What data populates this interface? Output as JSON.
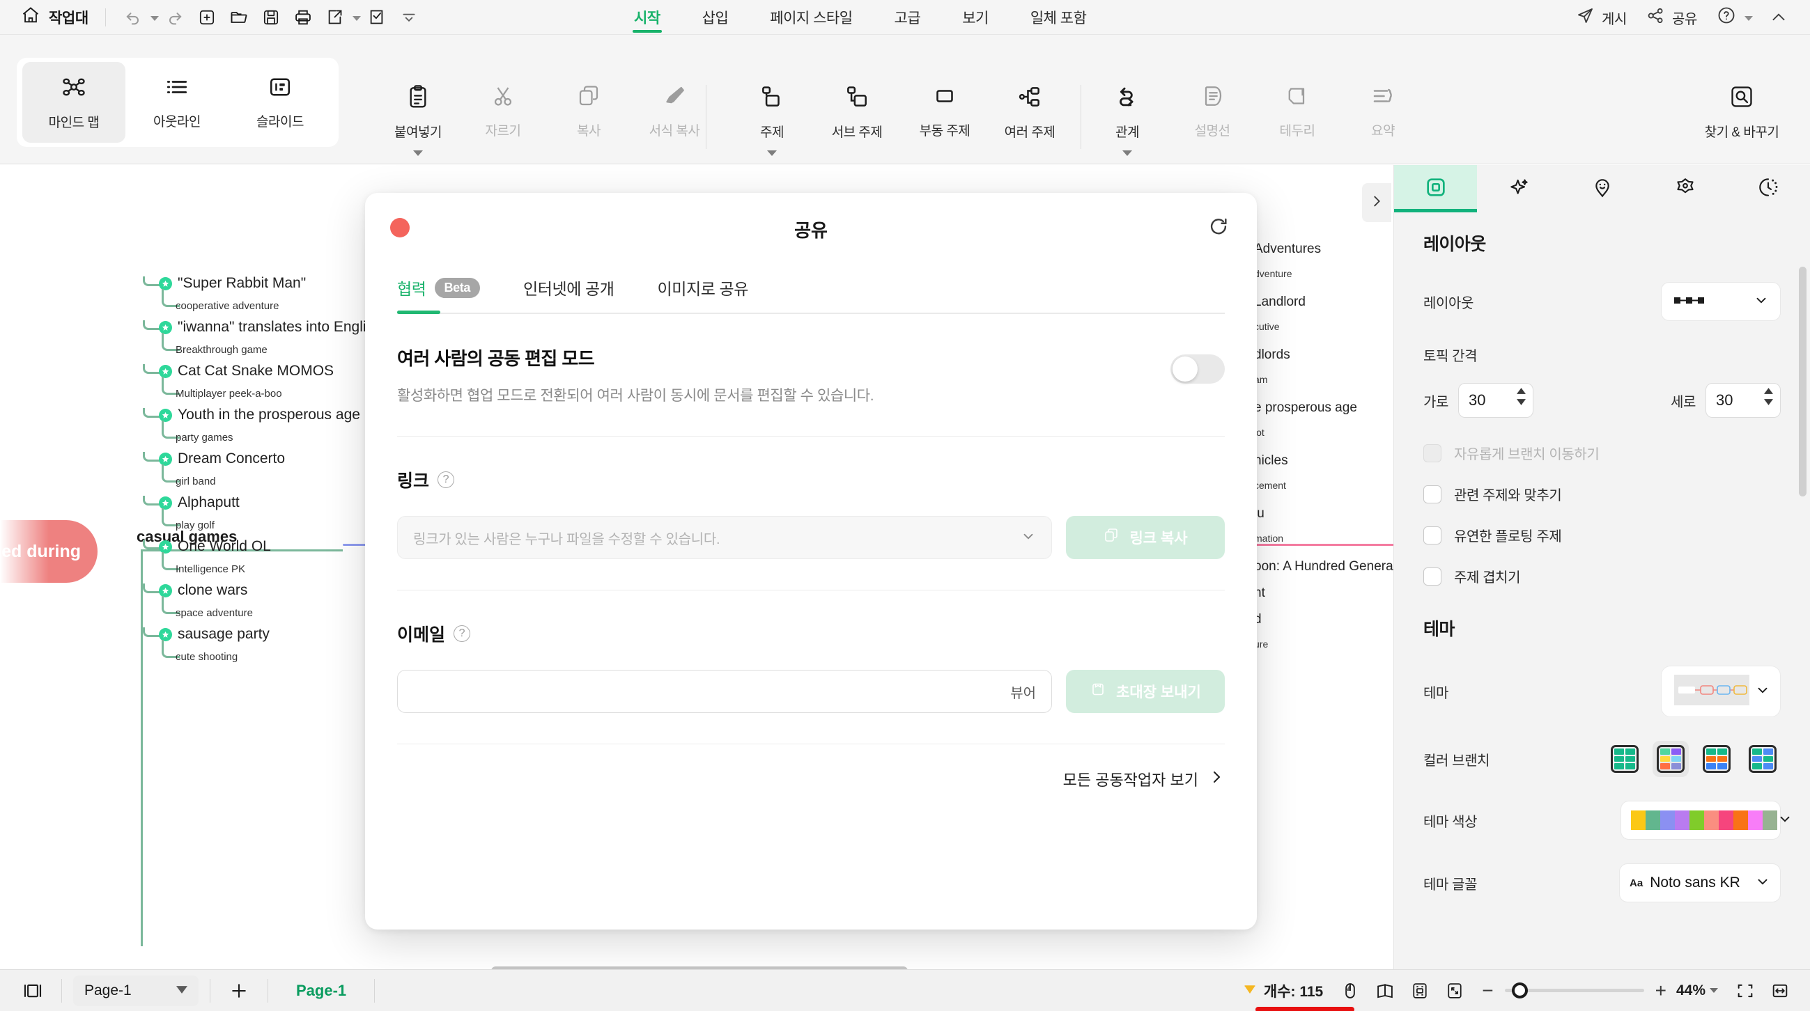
{
  "topbar": {
    "home_label": "작업대",
    "quick_icons": [
      "undo-icon",
      "redo-icon",
      "new-file-icon",
      "open-folder-icon",
      "save-icon",
      "print-icon",
      "export-icon",
      "task-icon",
      "more-icon"
    ],
    "tabs": [
      {
        "label": "시작",
        "active": true
      },
      {
        "label": "삽입",
        "active": false
      },
      {
        "label": "페이지 스타일",
        "active": false
      },
      {
        "label": "고급",
        "active": false
      },
      {
        "label": "보기",
        "active": false
      },
      {
        "label": "일체 포함",
        "active": false
      }
    ],
    "right": [
      {
        "label": "게시",
        "icon": "send-icon"
      },
      {
        "label": "공유",
        "icon": "share-icon"
      }
    ],
    "help_icon": "help-circle-icon",
    "collapse_icon": "chevron-up-icon",
    "accent": "#18b26a"
  },
  "ribbon": {
    "views": [
      {
        "label": "마인드 맵",
        "icon": "mindmap-icon",
        "selected": true,
        "disabled": false
      },
      {
        "label": "아웃라인",
        "icon": "outline-icon",
        "selected": false,
        "disabled": false
      },
      {
        "label": "슬라이드",
        "icon": "slide-icon",
        "selected": false,
        "disabled": false
      }
    ],
    "clipboard": [
      {
        "label": "붙여넣기",
        "icon": "paste-icon",
        "disabled": false,
        "dropdown": true
      },
      {
        "label": "자르기",
        "icon": "cut-icon",
        "disabled": true,
        "dropdown": false
      },
      {
        "label": "복사",
        "icon": "copy-icon",
        "disabled": true,
        "dropdown": false
      },
      {
        "label": "서식 복사",
        "icon": "format-painter-icon",
        "disabled": true,
        "dropdown": false
      }
    ],
    "topics": [
      {
        "label": "주제",
        "icon": "topic-icon",
        "disabled": false,
        "dropdown": true
      },
      {
        "label": "서브 주제",
        "icon": "subtopic-icon",
        "disabled": false,
        "dropdown": false
      },
      {
        "label": "부동 주제",
        "icon": "floating-topic-icon",
        "disabled": false,
        "dropdown": false
      },
      {
        "label": "여러 주제",
        "icon": "multi-topic-icon",
        "disabled": false,
        "dropdown": false
      }
    ],
    "relations": [
      {
        "label": "관계",
        "icon": "relation-icon",
        "disabled": false,
        "dropdown": true
      },
      {
        "label": "설명선",
        "icon": "callout-icon",
        "disabled": true,
        "dropdown": false
      },
      {
        "label": "테두리",
        "icon": "boundary-icon",
        "disabled": true,
        "dropdown": false
      },
      {
        "label": "요약",
        "icon": "summary-icon",
        "disabled": true,
        "dropdown": false
      }
    ],
    "find": {
      "label": "찾기 & 바꾸기",
      "icon": "find-replace-icon"
    }
  },
  "canvas": {
    "root_node": "ed during",
    "branch_title": "casual games",
    "items": [
      {
        "main": "\"Super Rabbit Man\"",
        "sub": "cooperative adventure"
      },
      {
        "main": "\"iwanna\" translates into English as \"I want\".",
        "sub": "Breakthrough game"
      },
      {
        "main": "Cat Cat Snake MOMOS",
        "sub": "Multiplayer peek-a-boo"
      },
      {
        "main": "Youth in the prosperous age",
        "sub": "party games"
      },
      {
        "main": "Dream Concerto",
        "sub": "girl band"
      },
      {
        "main": "Alphaputt",
        "sub": "play golf"
      },
      {
        "main": "One World OL",
        "sub": "Intelligence PK"
      },
      {
        "main": "clone wars",
        "sub": "space adventure"
      },
      {
        "main": "sausage party",
        "sub": "cute shooting"
      }
    ],
    "right_fragments": [
      {
        "text": "Adventures",
        "small": false
      },
      {
        "text": "dventure",
        "small": true
      },
      {
        "text": "Landlord",
        "small": false
      },
      {
        "text": "cutive",
        "small": true
      },
      {
        "text": "dlords",
        "small": false
      },
      {
        "text": "am",
        "small": true
      },
      {
        "text": "e prosperous age",
        "small": false
      },
      {
        "text": "lot",
        "small": true
      },
      {
        "text": "nicles",
        "small": false
      },
      {
        "text": "cement",
        "small": true
      },
      {
        "text": "lu",
        "small": false
      },
      {
        "text": "mation",
        "small": true
      },
      {
        "text": "oon: A Hundred Generals",
        "small": false
      },
      {
        "text": "ht",
        "small": false
      },
      {
        "text": "d",
        "small": false
      },
      {
        "text": "ure",
        "small": true
      }
    ]
  },
  "modal": {
    "title": "공유",
    "close_icon": "close-dot-icon",
    "refresh_icon": "refresh-icon",
    "tabs": [
      {
        "label": "협력",
        "badge": "Beta",
        "active": true
      },
      {
        "label": "인터넷에 공개",
        "badge": "",
        "active": false
      },
      {
        "label": "이미지로 공유",
        "badge": "",
        "active": false
      }
    ],
    "collab": {
      "heading": "여러 사람의 공동 편집 모드",
      "desc": "활성화하면 협업 모드로 전환되어 여러 사람이 동시에 문서를 편집할 수 있습니다.",
      "toggle_on": false
    },
    "link": {
      "label": "링크",
      "help_icon": "question-mark-icon",
      "placeholder": "링크가 있는 사람은 누구나 파일을 수정할 수 있습니다.",
      "dropdown_icon": "chevron-down-icon",
      "button_label": "링크 복사",
      "button_icon": "copy-icon"
    },
    "email": {
      "label": "이메일",
      "help_icon": "question-mark-icon",
      "value": "",
      "role": "뷰어",
      "button_label": "초대장 보내기",
      "button_icon": "mail-icon"
    },
    "footer_link": "모든 공동작업자 보기",
    "footer_icon": "chevron-right-icon"
  },
  "right_panel": {
    "tabs": [
      {
        "icon": "layout-square-icon",
        "active": true
      },
      {
        "icon": "sparkle-icon",
        "active": false
      },
      {
        "icon": "sticker-smiley-icon",
        "active": false
      },
      {
        "icon": "flower-icon",
        "active": false
      },
      {
        "icon": "clock-history-icon",
        "active": false
      }
    ],
    "layout": {
      "section_title": "레이아웃",
      "layout_label": "레이아웃",
      "layout_value_icon": "layout-horizontal-icon",
      "spacing_title": "토픽 간격",
      "horizontal_label": "가로",
      "horizontal_value": "30",
      "vertical_label": "세로",
      "vertical_value": "30",
      "checkboxes": [
        {
          "label": "자유롭게 브랜치 이동하기",
          "checked": false,
          "disabled": true
        },
        {
          "label": "관련 주제와 맞추기",
          "checked": false,
          "disabled": false
        },
        {
          "label": "유연한 플로팅 주제",
          "checked": false,
          "disabled": false
        },
        {
          "label": "주제 겹치기",
          "checked": false,
          "disabled": false
        }
      ]
    },
    "theme": {
      "section_title": "테마",
      "theme_label": "테마",
      "color_branch_label": "컬러 브랜치",
      "branch_options": [
        {
          "name": "all-green",
          "selected": false,
          "colors": [
            "#16b98a",
            "#16b98a",
            "#16b98a",
            "#16b98a",
            "#16b98a",
            "#16b98a"
          ]
        },
        {
          "name": "rainbow",
          "selected": true,
          "colors": [
            "#4fd6a0",
            "#8b5cf6",
            "#ffd93d",
            "#7fd4f5",
            "#ff7043",
            "#8a8ed8"
          ]
        },
        {
          "name": "green-orange-blue",
          "selected": false,
          "colors": [
            "#16b98a",
            "#16b98a",
            "#f97316",
            "#f97316",
            "#3b82f6",
            "#3b82f6"
          ]
        },
        {
          "name": "green-blue-mix",
          "selected": false,
          "colors": [
            "#16b98a",
            "#4c8bf5",
            "#4c8bf5",
            "#16b98a",
            "#16b98a",
            "#4c8bf5"
          ]
        }
      ],
      "theme_color_label": "테마 색상",
      "theme_colors": [
        "#fbc816",
        "#62b68e",
        "#8b90f2",
        "#b97bf0",
        "#80cc2a",
        "#fa8e80",
        "#f6457d",
        "#f97316",
        "#f87df8",
        "#97b392"
      ],
      "theme_font_label": "테마 글꼴",
      "theme_font_value": "Noto sans KR",
      "font_icon": "Aa"
    }
  },
  "status": {
    "view_icon": "sidebar-toggle-icon",
    "page_select_value": "Page-1",
    "add_page_icon": "plus-icon",
    "page_tab": "Page-1",
    "count_label": "개수: 115",
    "count_icon": "diamond-icon",
    "mode_icons": [
      "mouse-icon",
      "map-icon",
      "focus-icon",
      "fullscreen-icon"
    ],
    "zoom_minus": "−",
    "zoom_plus": "+",
    "zoom_value": "44%",
    "zoom_caret_icon": "chevron-down-icon",
    "fit_icon": "fit-screen-icon",
    "width_icon": "fit-width-icon"
  }
}
